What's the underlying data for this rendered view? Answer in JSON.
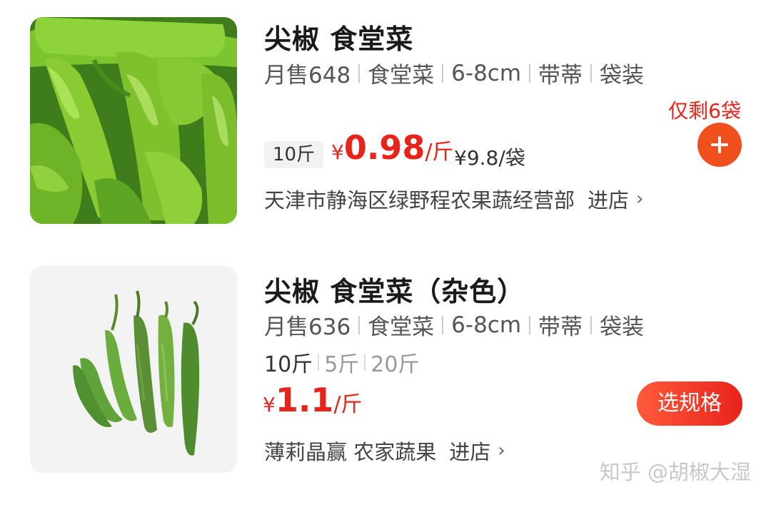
{
  "products": [
    {
      "title": "尖椒 食堂菜",
      "tags": [
        "月售648",
        "食堂菜",
        "6-8cm",
        "带蒂",
        "袋装"
      ],
      "spec": "10斤",
      "price": {
        "currency": "¥",
        "value": "0.98",
        "unit": "/斤"
      },
      "bag_price": "¥9.8/袋",
      "stock_note": "仅剩6袋",
      "shop_name": "天津市静海区绿野程农果蔬经营部",
      "enter_label": "进店",
      "action_icon": "plus-icon"
    },
    {
      "title": "尖椒 食堂菜（杂色）",
      "tags": [
        "月售636",
        "食堂菜",
        "6-8cm",
        "带蒂",
        "袋装"
      ],
      "specs": [
        "10斤",
        "5斤",
        "20斤"
      ],
      "price": {
        "currency": "¥",
        "value": "1.1",
        "unit": "/斤"
      },
      "choose_label": "选规格",
      "shop_name": "薄莉晶赢 农家蔬果",
      "enter_label": "进店"
    }
  ],
  "watermark": "知乎 @胡椒大湿",
  "colors": {
    "accent": "#e8231a",
    "button": "#f0501e"
  }
}
